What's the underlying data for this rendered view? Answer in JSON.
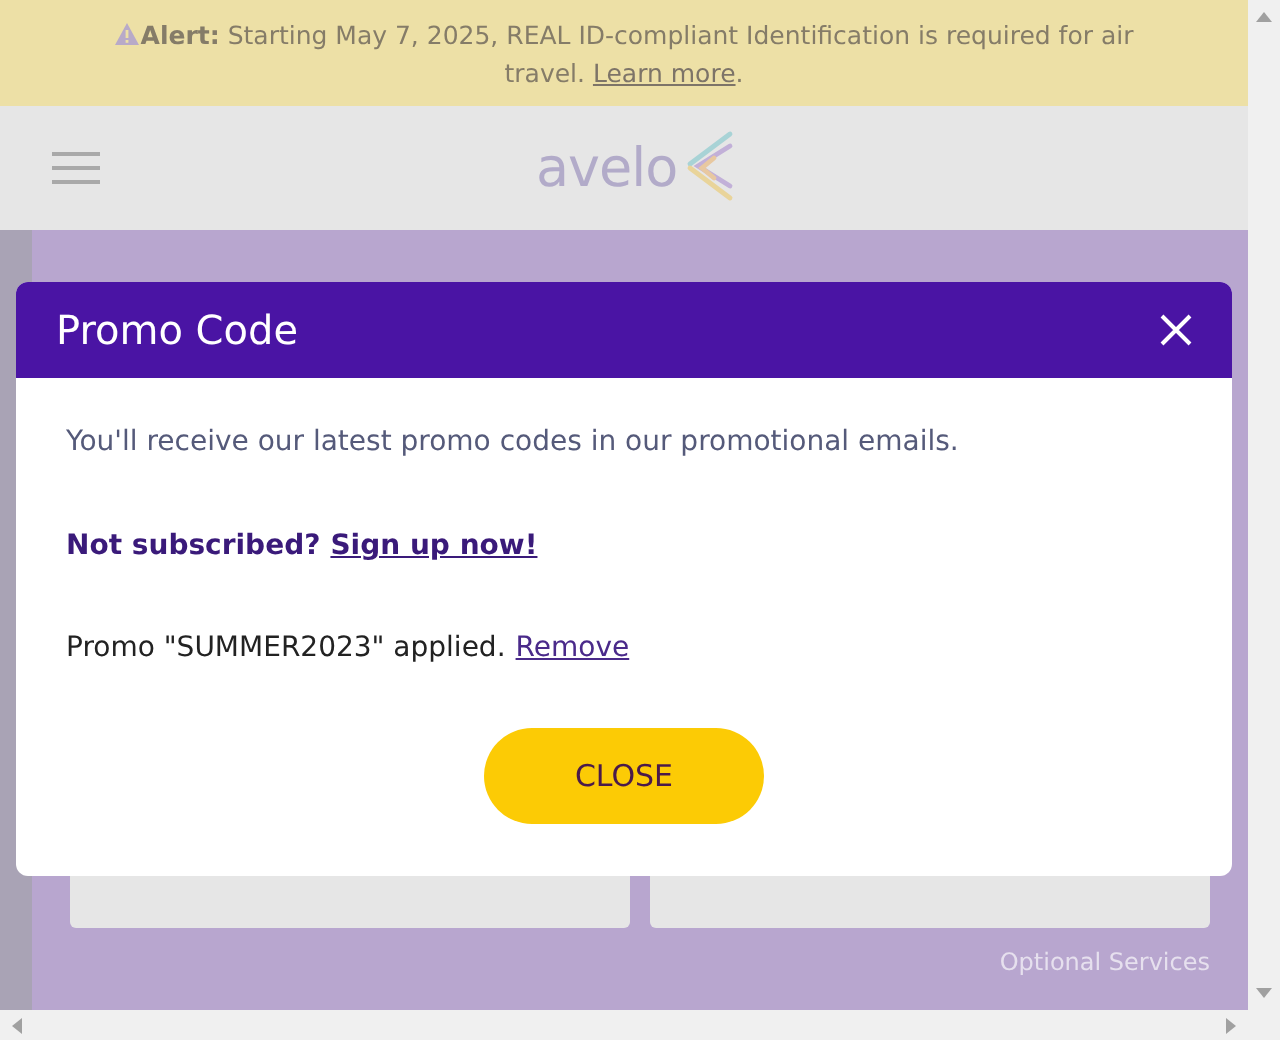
{
  "alert": {
    "text": "**Alert:** Starting May 7, 2025, REAL ID-compliant Identification is required for air travel.",
    "link": "Learn more",
    "suffix": "."
  },
  "header": {
    "logo": "avelo"
  },
  "background": {
    "footer_link": "Optional Services"
  },
  "modal": {
    "title": "Promo Code",
    "intro": "You'll receive our latest promo codes in our promotional emails.",
    "subscribe_prompt": "Not subscribed?",
    "subscribe_link": "Sign up now!",
    "promo_status": "Promo \"SUMMER2023\" applied.",
    "remove_link": "Remove",
    "close_button": "CLOSE"
  }
}
